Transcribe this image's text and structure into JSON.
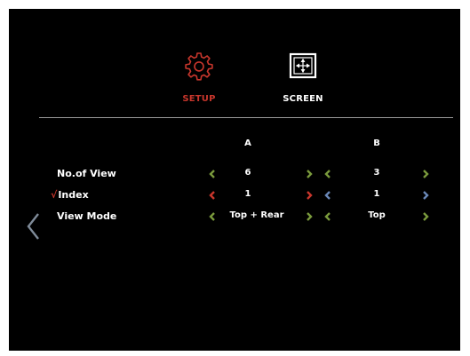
{
  "tabs": [
    {
      "label": "SETUP",
      "icon": "gear-icon",
      "active": true,
      "color": "#c8362c"
    },
    {
      "label": "SCREEN",
      "icon": "screen-move-icon",
      "active": false,
      "color": "#ffffff"
    }
  ],
  "columns": [
    "A",
    "B"
  ],
  "rows": [
    {
      "label": "No.of View",
      "checked": false,
      "values": [
        "6",
        "3"
      ]
    },
    {
      "label": "Index",
      "checked": true,
      "check_mark": "√",
      "values": [
        "1",
        "1"
      ]
    },
    {
      "label": "View Mode",
      "checked": false,
      "values": [
        "Top + Rear",
        "Top"
      ]
    }
  ],
  "colors": {
    "accent_red": "#c8362c",
    "arrow_green": "#7a9a3c",
    "arrow_blue": "#6a88b8",
    "arrow_red": "#c8362c",
    "back_arrow": "#7f8b99",
    "background": "#000000"
  },
  "icons": {
    "back": "chevron-left-icon",
    "decrease": "chevron-left-icon",
    "increase": "chevron-right-icon"
  }
}
